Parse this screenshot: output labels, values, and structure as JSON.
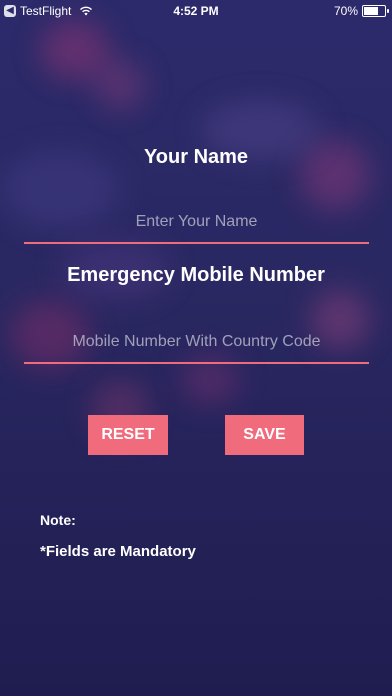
{
  "status_bar": {
    "back_app": "TestFlight",
    "back_glyph": "◀",
    "time": "4:52 PM",
    "battery": "70%",
    "battery_level": 0.7
  },
  "form": {
    "name_title": "Your Name",
    "name_placeholder": "Enter Your Name",
    "name_value": "",
    "emergency_title": "Emergency Mobile Number",
    "phone_placeholder": "Mobile Number With Country Code",
    "phone_value": ""
  },
  "buttons": {
    "reset_label": "RESET",
    "save_label": "SAVE"
  },
  "note": {
    "label": "Note:",
    "text": "*Fields are Mandatory"
  },
  "colors": {
    "accent": "#f06b7c",
    "background": "#2c2a6b"
  }
}
